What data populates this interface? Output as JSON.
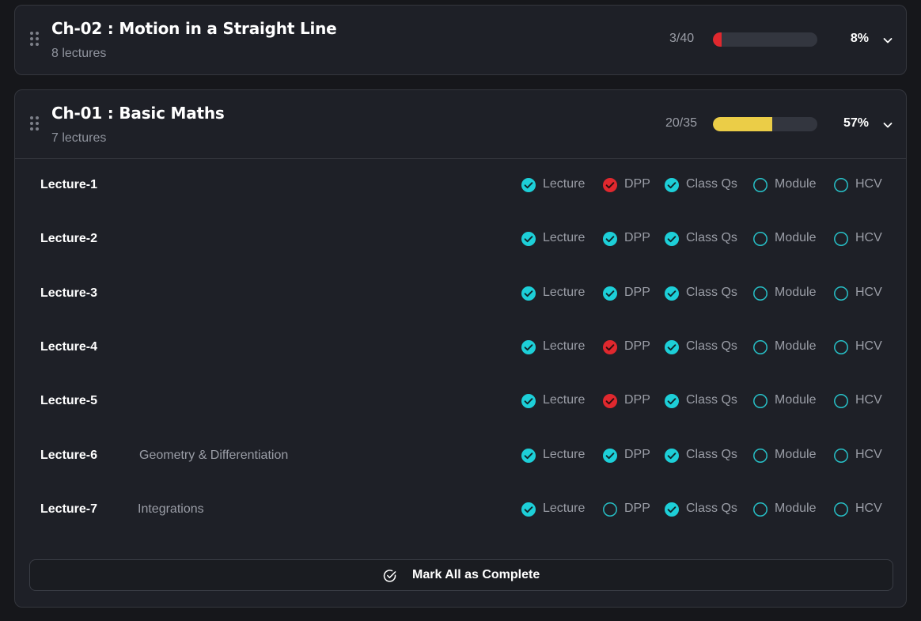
{
  "colors": {
    "done": "#1dcfd8",
    "missed": "#e0282e",
    "pending_ring": "#27bfc6",
    "progress_low": "#e0282e",
    "progress_mid": "#ebcd47"
  },
  "chapters": [
    {
      "title": "Ch-02 : Motion in a Straight Line",
      "subtitle": "8 lectures",
      "count": "3/40",
      "percent_label": "8%",
      "progress": 0.08,
      "expanded": false
    },
    {
      "title": "Ch-01 : Basic Maths",
      "subtitle": "7 lectures",
      "count": "20/35",
      "percent_label": "57%",
      "progress": 0.57,
      "expanded": true,
      "task_labels": [
        "Lecture",
        "DPP",
        "Class Qs",
        "Module",
        "HCV"
      ],
      "lectures": [
        {
          "name": "Lecture-1",
          "topic": "",
          "tasks": [
            "done",
            "missed",
            "done",
            "pending",
            "pending"
          ]
        },
        {
          "name": "Lecture-2",
          "topic": "",
          "tasks": [
            "done",
            "done",
            "done",
            "pending",
            "pending"
          ]
        },
        {
          "name": "Lecture-3",
          "topic": "",
          "tasks": [
            "done",
            "done",
            "done",
            "pending",
            "pending"
          ]
        },
        {
          "name": "Lecture-4",
          "topic": "",
          "tasks": [
            "done",
            "missed",
            "done",
            "pending",
            "pending"
          ]
        },
        {
          "name": "Lecture-5",
          "topic": "",
          "tasks": [
            "done",
            "missed",
            "done",
            "pending",
            "pending"
          ]
        },
        {
          "name": "Lecture-6",
          "topic": "Geometry & Differentiation",
          "tasks": [
            "done",
            "done",
            "done",
            "pending",
            "pending"
          ]
        },
        {
          "name": "Lecture-7",
          "topic": "Integrations",
          "tasks": [
            "done",
            "pending",
            "done",
            "pending",
            "pending"
          ]
        }
      ],
      "mark_all_label": "Mark All as Complete"
    }
  ]
}
